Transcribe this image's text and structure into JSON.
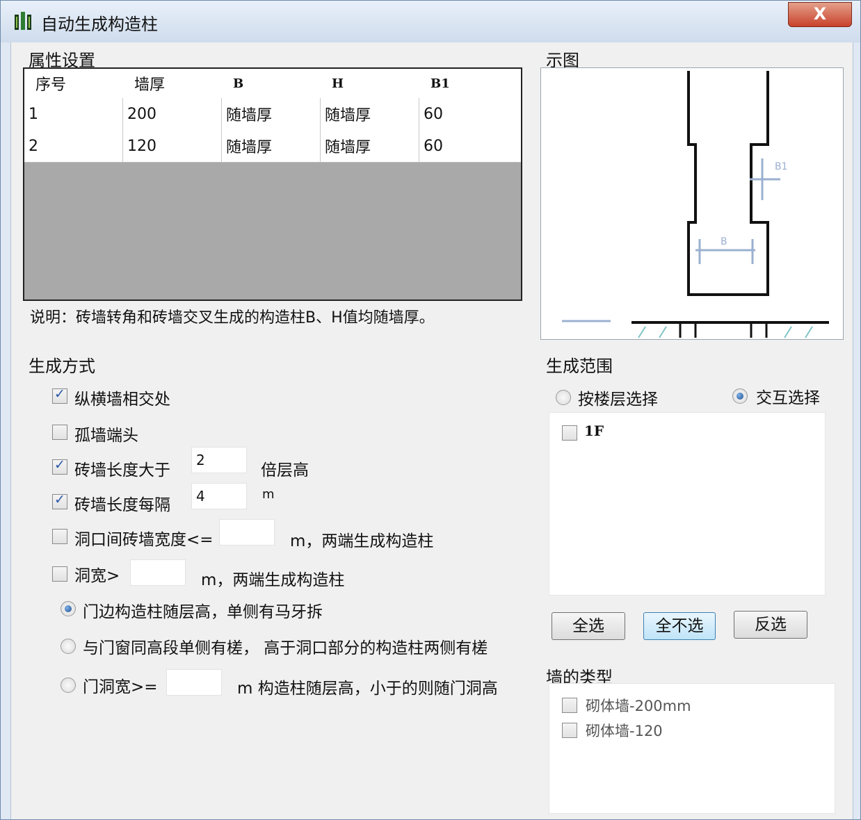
{
  "window": {
    "title": "自动生成构造柱",
    "close_label": "X"
  },
  "properties": {
    "section_title": "属性设置",
    "columns": [
      "序号",
      "墙厚",
      "B",
      "H",
      "B1"
    ],
    "rows": [
      [
        "1",
        "200",
        "随墙厚",
        "随墙厚",
        "60"
      ],
      [
        "2",
        "120",
        "随墙厚",
        "随墙厚",
        "60"
      ]
    ],
    "note": "说明：砖墙转角和砖墙交叉生成的构造柱B、H值均随墙厚。"
  },
  "diagram": {
    "section_title": "示图",
    "label_b": "B",
    "label_b1": "B1"
  },
  "generation": {
    "section_title": "生成方式",
    "opt_intersection": {
      "label": "纵横墙相交处",
      "checked": true
    },
    "opt_isolated_end": {
      "label": "孤墙端头",
      "checked": false
    },
    "opt_length_greater": {
      "label": "砖墙长度大于",
      "value": "2",
      "suffix": "倍层高",
      "checked": true
    },
    "opt_length_every": {
      "label": "砖墙长度每隔",
      "value": "4",
      "suffix": "m",
      "checked": true
    },
    "opt_opening_gap": {
      "label": "洞口间砖墙宽度<=",
      "value": "",
      "suffix": "m，两端生成构造柱",
      "checked": false
    },
    "opt_opening_width": {
      "label": "洞宽>",
      "value": "",
      "suffix": "m，两端生成构造柱",
      "checked": false
    },
    "radio_door_full": {
      "label": "门边构造柱随层高，单侧有马牙拆",
      "checked": true
    },
    "radio_same_height": {
      "label": "与门窗同高段单侧有槎，  高于洞口部分的构造柱两侧有槎",
      "checked": false
    },
    "radio_door_width": {
      "label": "门洞宽>=",
      "value": "",
      "suffix": "m  构造柱随层高，小于的则随门洞高",
      "checked": false
    }
  },
  "scope": {
    "section_title": "生成范围",
    "radio_by_floor": {
      "label": "按楼层选择",
      "checked": false
    },
    "radio_interactive": {
      "label": "交互选择",
      "checked": true
    },
    "floors": [
      {
        "label": "1F",
        "checked": false
      }
    ],
    "btn_select_all": "全选",
    "btn_select_none": "全不选",
    "btn_invert": "反选"
  },
  "wall_types": {
    "section_title": "墙的类型",
    "items": [
      {
        "label": "砌体墙-200mm",
        "checked": false
      },
      {
        "label": "砌体墙-120",
        "checked": false
      }
    ]
  }
}
